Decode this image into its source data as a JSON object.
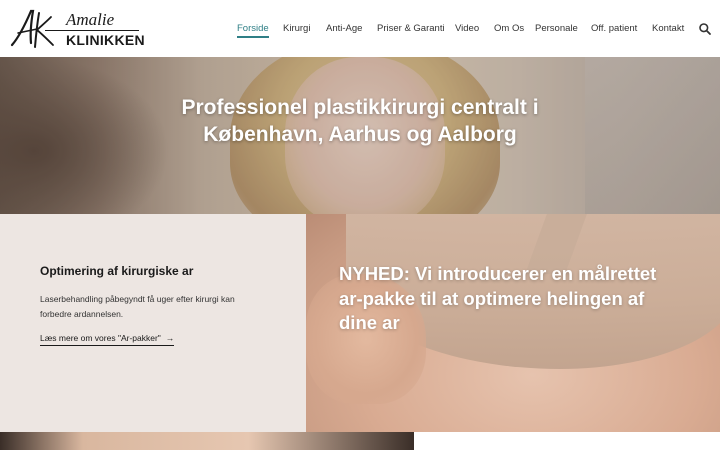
{
  "logo": {
    "script": "Amalie",
    "name": "KLINIKKEN"
  },
  "nav": {
    "items": [
      {
        "label": "Forside",
        "active": true
      },
      {
        "label": "Kirurgi",
        "active": false
      },
      {
        "label": "Anti-Age",
        "active": false
      },
      {
        "label": "Priser & Garanti",
        "active": false
      },
      {
        "label": "Video",
        "active": false
      },
      {
        "label": "Om Os",
        "active": false
      },
      {
        "label": "Personale",
        "active": false
      },
      {
        "label": "Off. patient",
        "active": false
      },
      {
        "label": "Kontakt",
        "active": false
      }
    ],
    "search_icon": "search-icon"
  },
  "hero": {
    "title": "Professionel plastikkirurgi centralt i København, Aarhus og Aalborg"
  },
  "promo": {
    "heading": "Optimering af kirurgiske ar",
    "body": "Laserbehandling påbegyndt få uger efter kirurgi kan forbedre ardannelsen.",
    "link": "Læs mere om vores \"Ar-pakker\"",
    "link_arrow": "→",
    "news": "NYHED: Vi introducerer en målrettet ar-pakke til at optimere helingen af dine ar"
  },
  "colors": {
    "accent": "#2f7f86",
    "section_bg": "#ede6e2",
    "text": "#1a1a1a"
  }
}
